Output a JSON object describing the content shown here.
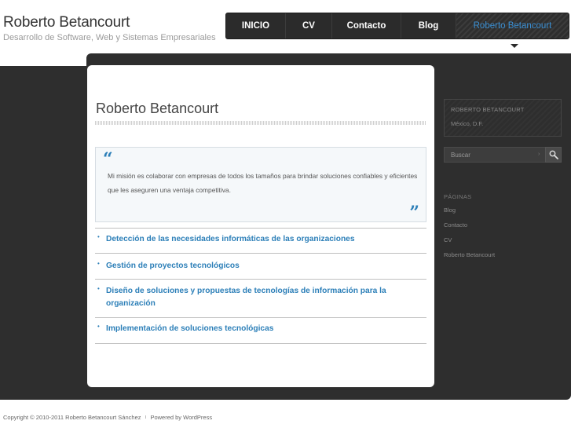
{
  "header": {
    "site_title": "Roberto Betancourt",
    "site_description": "Desarrollo de Software, Web y Sistemas Empresariales"
  },
  "nav": {
    "items": [
      {
        "label": "INICIO"
      },
      {
        "label": "CV"
      },
      {
        "label": "Contacto"
      },
      {
        "label": "Blog"
      },
      {
        "label": "Roberto Betancourt",
        "active": true
      }
    ]
  },
  "main": {
    "page_title": "Roberto Betancourt",
    "quote": {
      "open_mark": "“",
      "text": "Mi misión es colaborar con empresas de todos los tamaños para brindar soluciones confiables y eficientes que les aseguren una ventaja competitiva.",
      "close_mark": "”"
    },
    "bullet_char": "•",
    "items": [
      {
        "label": "Detección de las necesidades informáticas de las organizaciones"
      },
      {
        "label": "Gestión de proyectos tecnológicos"
      },
      {
        "label": "Diseño de soluciones y propuestas de tecnologías de información para la organización"
      },
      {
        "label": "Implementación de soluciones tecnológicas"
      }
    ]
  },
  "sidebar": {
    "author_name": "ROBERTO BETANCOURT",
    "author_location": "México, D.F.",
    "search": {
      "placeholder": "Buscar",
      "separator": "›",
      "button_icon": "search-icon"
    },
    "pages_heading": "PÁGINAS",
    "pages": [
      {
        "label": "Blog"
      },
      {
        "label": "Contacto"
      },
      {
        "label": "CV"
      },
      {
        "label": "Roberto Betancourt"
      }
    ]
  },
  "footer": {
    "copyright": "Copyright ©  2010-2011  Roberto Betancourt Sánchez",
    "separator": "ı",
    "powered": "Powered by WordPress"
  },
  "colors": {
    "accent": "#2c7fb8",
    "dark_background": "#2e2e2e",
    "nav_background": "#2b2b2b",
    "active_nav_text": "#3a8fd3"
  }
}
